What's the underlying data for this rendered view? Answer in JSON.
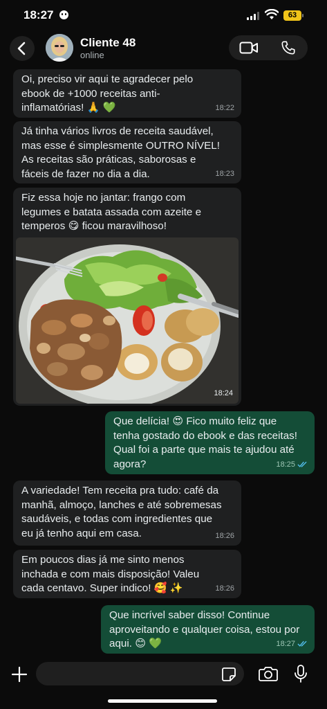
{
  "status_bar": {
    "time": "18:27",
    "battery": "63"
  },
  "header": {
    "name": "Cliente 48",
    "status": "online",
    "icons": [
      "back-chevron-icon",
      "video-call-icon",
      "phone-call-icon"
    ]
  },
  "messages": [
    {
      "direction": "in",
      "text": "Oi, preciso vir aqui te agradecer pelo\nebook de +1000 receitas anti-\ninflamatórias! 🙏 💚",
      "time": "18:22"
    },
    {
      "direction": "in",
      "text": "Já tinha vários livros de receita saudável,\nmas esse é simplesmente OUTRO NÍVEL!\nAs receitas são práticas, saborosas e\nfáceis de fazer no dia a dia.",
      "time": "18:23"
    },
    {
      "direction": "in",
      "text": "Fiz essa hoje no jantar: frango com\nlegumes e batata assada com azeite e\ntemperos 😋 ficou maravilhoso!",
      "time": "18:24",
      "image": "meal-photo"
    },
    {
      "direction": "out",
      "text": "Que delícia! 😍 Fico muito feliz que\ntenha gostado do ebook e das receitas!\nQual foi a parte que mais te ajudou até\nagora?",
      "time": "18:25",
      "read": true
    },
    {
      "direction": "in",
      "text": "A variedade! Tem receita pra tudo: café da\nmanhã, almoço, lanches e até sobremesas\nsaudáveis, e todas com ingredientes que\neu já tenho aqui em casa.",
      "time": "18:26"
    },
    {
      "direction": "in",
      "text": "Em poucos dias já me sinto menos\ninchada e com mais disposição! Valeu\ncada centavo. Super indico! 🥰 ✨",
      "time": "18:26"
    },
    {
      "direction": "out",
      "text": "Que incrível saber disso! Continue\naproveitando e qualquer coisa, estou por\naqui. 😊 💚",
      "time": "18:27",
      "read": true
    }
  ],
  "input": {
    "value": "",
    "icons": [
      "plus-icon",
      "sticker-icon",
      "camera-icon",
      "microphone-icon"
    ]
  },
  "colors": {
    "background": "#0b0b0b",
    "incoming_bubble": "#1f2021",
    "outgoing_bubble": "#144d37",
    "read_ticks": "#53bdeb",
    "battery": "#f0c419"
  }
}
